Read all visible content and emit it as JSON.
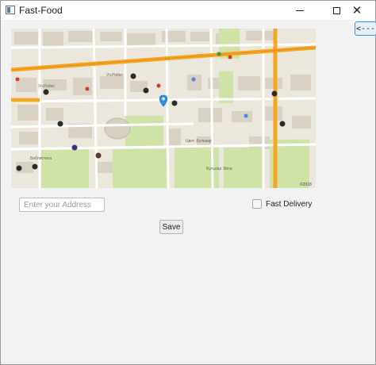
{
  "window": {
    "title": "Fast-Food",
    "minimize_icon": "minimize-icon",
    "maximize_icon": "maximize-icon",
    "close_icon": "close-icon",
    "close_glyph": "✕"
  },
  "toolbar": {
    "back_label": "<---"
  },
  "map": {
    "streets": [
      "Ул.Ройко",
      "Ул.Ройко",
      "Цвет. Бульвар",
      "Библиотека",
      "Бульвар Эйна"
    ],
    "copyright": "©2018"
  },
  "form": {
    "address_placeholder": "Enter your Address",
    "address_value": "",
    "fast_delivery_label": "Fast Delivery",
    "fast_delivery_checked": false,
    "save_label": "Save"
  },
  "colors": {
    "accent": "#3c8fd6",
    "road_major": "#f5a623",
    "park": "#cfe3a6",
    "water": "#aad3df"
  }
}
